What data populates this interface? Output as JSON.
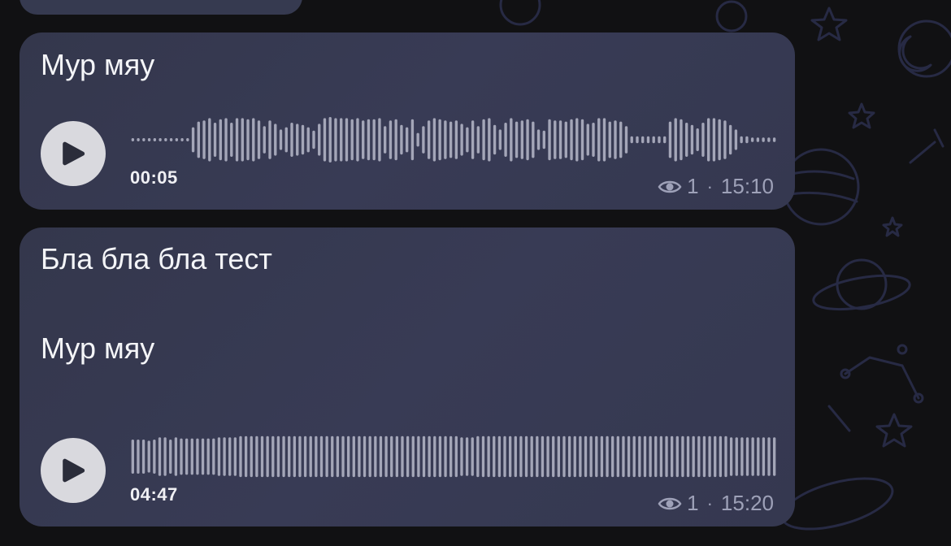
{
  "messages": [
    {
      "lines": [
        "Мур мяу"
      ],
      "voice": {
        "duration": "00:05",
        "waveform": [
          0.05,
          0.05,
          0.05,
          0.05,
          0.05,
          0.05,
          0.05,
          0.05,
          0.05,
          0.05,
          0.05,
          0.55,
          0.8,
          0.85,
          0.95,
          0.75,
          0.9,
          0.95,
          0.75,
          0.95,
          0.95,
          0.9,
          0.95,
          0.85,
          0.6,
          0.85,
          0.7,
          0.45,
          0.55,
          0.75,
          0.7,
          0.65,
          0.55,
          0.4,
          0.7,
          0.95,
          1.0,
          0.95,
          0.95,
          0.95,
          0.9,
          0.95,
          0.85,
          0.9,
          0.9,
          0.95,
          0.6,
          0.85,
          0.9,
          0.65,
          0.55,
          0.9,
          0.3,
          0.6,
          0.85,
          0.95,
          0.9,
          0.85,
          0.8,
          0.85,
          0.7,
          0.55,
          0.85,
          0.6,
          0.9,
          0.95,
          0.65,
          0.45,
          0.75,
          0.95,
          0.8,
          0.85,
          0.9,
          0.8,
          0.45,
          0.4,
          0.9,
          0.85,
          0.85,
          0.8,
          0.9,
          0.95,
          0.9,
          0.7,
          0.75,
          0.95,
          0.95,
          0.8,
          0.85,
          0.8,
          0.6,
          0.15,
          0.15,
          0.15,
          0.15,
          0.15,
          0.15,
          0.15,
          0.8,
          0.95,
          0.9,
          0.75,
          0.65,
          0.5,
          0.75,
          0.95,
          0.95,
          0.9,
          0.85,
          0.65,
          0.45,
          0.15,
          0.15,
          0.1,
          0.1,
          0.1,
          0.1,
          0.1
        ]
      },
      "views": "1",
      "time": "15:10"
    },
    {
      "lines": [
        "Бла бла бла тест",
        "Мур мяу"
      ],
      "voice": {
        "duration": "04:47",
        "waveform": [
          0.75,
          0.75,
          0.75,
          0.7,
          0.75,
          0.85,
          0.85,
          0.75,
          0.85,
          0.8,
          0.8,
          0.8,
          0.8,
          0.8,
          0.8,
          0.8,
          0.85,
          0.85,
          0.85,
          0.85,
          0.9,
          0.9,
          0.9,
          0.9,
          0.9,
          0.9,
          0.9,
          0.9,
          0.9,
          0.9,
          0.9,
          0.9,
          0.9,
          0.9,
          0.9,
          0.9,
          0.9,
          0.9,
          0.9,
          0.9,
          0.9,
          0.9,
          0.9,
          0.9,
          0.9,
          0.9,
          0.9,
          0.9,
          0.9,
          0.9,
          0.9,
          0.9,
          0.9,
          0.9,
          0.9,
          0.9,
          0.9,
          0.9,
          0.9,
          0.9,
          0.9,
          0.85,
          0.85,
          0.85,
          0.9,
          0.9,
          0.9,
          0.9,
          0.9,
          0.9,
          0.9,
          0.9,
          0.9,
          0.9,
          0.9,
          0.9,
          0.9,
          0.9,
          0.9,
          0.9,
          0.9,
          0.9,
          0.9,
          0.9,
          0.9,
          0.9,
          0.9,
          0.9,
          0.9,
          0.9,
          0.9,
          0.9,
          0.9,
          0.9,
          0.9,
          0.9,
          0.9,
          0.9,
          0.9,
          0.9,
          0.9,
          0.9,
          0.9,
          0.9,
          0.9,
          0.9,
          0.9,
          0.9,
          0.9,
          0.9,
          0.9,
          0.85,
          0.85,
          0.85,
          0.85,
          0.85,
          0.85,
          0.85,
          0.85,
          0.85
        ]
      },
      "views": "1",
      "time": "15:20"
    }
  ],
  "icons": {
    "play": "play-icon",
    "views": "eye-icon"
  },
  "colors": {
    "background": "#111113",
    "bubble": "#363a52",
    "waveform": "#a4a6b8",
    "play_button": "#d9d9de",
    "meta_text": "#9ea1b8"
  }
}
